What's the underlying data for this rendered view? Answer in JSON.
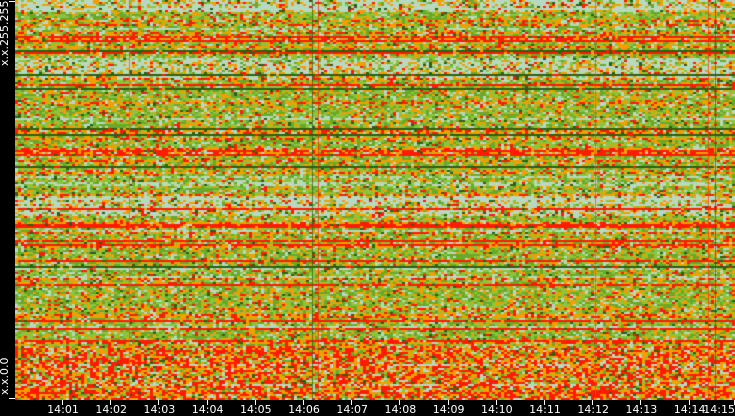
{
  "chart_data": {
    "type": "heatmap",
    "title": "",
    "xlabel": "",
    "ylabel": "",
    "x_ticks": [
      "14:01",
      "14:02",
      "14:03",
      "14:04",
      "14:05",
      "14:06",
      "14:07",
      "14:08",
      "14:09",
      "14:10",
      "14:11",
      "14:12",
      "14:13",
      "14:14",
      "14:15"
    ],
    "y_labels": {
      "top": "x.x.255.255",
      "bottom": "x.x.0.0"
    },
    "color_scale": {
      "very_low": "#b8d8c0",
      "low": "#8cc43c",
      "mid": "#6aa82a",
      "high": "#f0a000",
      "very_high": "#ff1a00",
      "dense": "#2e5e14"
    },
    "grid": false
  }
}
